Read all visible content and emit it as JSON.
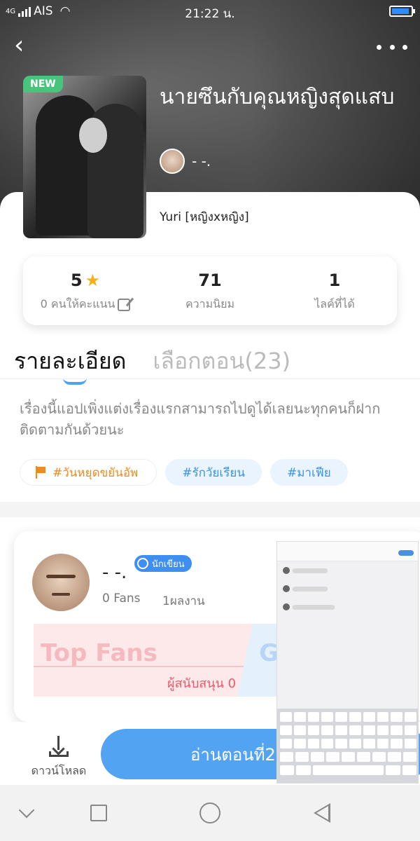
{
  "status_bar": {
    "network": "4G",
    "carrier": "AIS",
    "time": "21:22 น."
  },
  "book": {
    "badge": "NEW",
    "title": "นายซึนกับคุณหญิงสุดแสบ",
    "author_name": "- -.",
    "genre": "Yuri [หญิงxหญิง]"
  },
  "stats": [
    {
      "value": "5",
      "label": "0 คนให้คะแนน"
    },
    {
      "value": "71",
      "label": "ความนิยม"
    },
    {
      "value": "1",
      "label": "ไลค์ที่ได้"
    }
  ],
  "tabs": {
    "details": "รายละเอียด",
    "episodes": "เลือกตอน(23)"
  },
  "description": "เรื่องนี้แอปเพิ่งแต่งเรื่องแรกสามารถไปดูได้เลยนะทุกคนก็ฝากติดตามกันด้วยนะ",
  "tags": [
    {
      "label": "#วันหยุดขยันอัพ",
      "color": "#f08a1c"
    },
    {
      "label": "#รักวัยเรียน",
      "color": "#3a93e8"
    },
    {
      "label": "#มาเฟีย",
      "color": "#3a93e8"
    }
  ],
  "author_card": {
    "name": "- -.",
    "badge": "นักเขียน",
    "fans": "0 Fans",
    "works": "1ผลงาน",
    "top_fans_title": "Top Fans",
    "top_fans_sub": "ผู้สนับสนุน 0",
    "g_label": "G"
  },
  "action_bar": {
    "download_label": "ดาวน์โหลด",
    "read_label": "อ่านตอนที่2"
  },
  "colors": {
    "accent": "#52a3f2",
    "star": "#f6b01c",
    "new_badge": "#49c47d"
  }
}
